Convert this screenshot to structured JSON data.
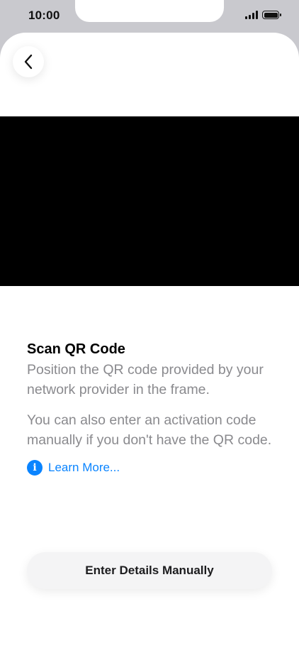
{
  "status_bar": {
    "time": "10:00",
    "icons": [
      "signal-icon",
      "battery-icon"
    ]
  },
  "nav": {
    "back_icon": "chevron-left-icon"
  },
  "scan": {
    "title": "Scan QR Code",
    "description": "Position the QR code provided by your network provider in the frame.",
    "alternate": "You can also enter an activation code manually if you don't have the QR code.",
    "learn_more_icon": "info-icon",
    "learn_more_glyph": "i",
    "learn_more_label": "Learn More..."
  },
  "actions": {
    "manual_label": "Enter Details Manually"
  },
  "colors": {
    "accent": "#0a84ff",
    "secondary_text": "#8a8a8e",
    "camera_frame": "#000000"
  }
}
